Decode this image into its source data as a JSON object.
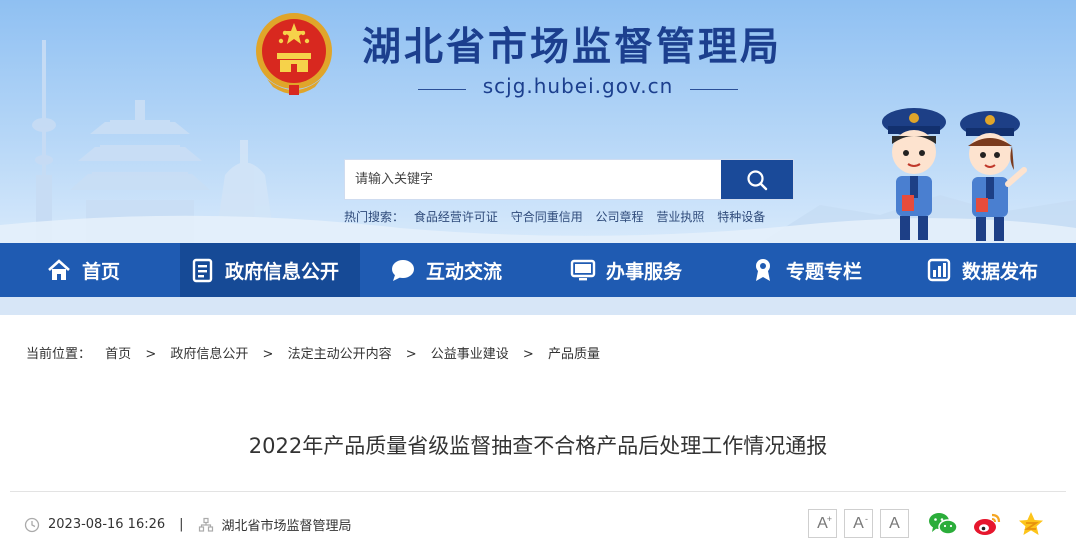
{
  "header": {
    "title": "湖北省市场监督管理局",
    "url": "scjg.hubei.gov.cn",
    "emblem_icon": "national-emblem-icon"
  },
  "search": {
    "placeholder": "请输入关键字",
    "button_icon": "search-icon"
  },
  "hot_search": {
    "label": "热门搜索：",
    "items": [
      "食品经营许可证",
      "守合同重信用",
      "公司章程",
      "营业执照",
      "特种设备"
    ]
  },
  "nav": {
    "items": [
      {
        "label": "首页",
        "icon": "home-icon"
      },
      {
        "label": "政府信息公开",
        "icon": "document-icon"
      },
      {
        "label": "互动交流",
        "icon": "chat-icon"
      },
      {
        "label": "办事服务",
        "icon": "monitor-icon"
      },
      {
        "label": "专题专栏",
        "icon": "ribbon-icon"
      },
      {
        "label": "数据发布",
        "icon": "chart-icon"
      }
    ],
    "active_index": 1
  },
  "breadcrumb": {
    "label": "当前位置：",
    "items": [
      "首页",
      "政府信息公开",
      "法定主动公开内容",
      "公益事业建设",
      "产品质量"
    ],
    "separator": ">"
  },
  "article": {
    "title": "2022年产品质量省级监督抽查不合格产品后处理工作情况通报",
    "date": "2023-08-16 16:26",
    "separator": "|",
    "source": "湖北省市场监督管理局"
  },
  "font_controls": {
    "increase": "A",
    "increase_mark": "+",
    "decrease": "A",
    "decrease_mark": "-",
    "reset": "A"
  },
  "share": [
    "wechat-icon",
    "weibo-icon",
    "qzone-icon"
  ],
  "colors": {
    "nav_bg": "#1f5bb2",
    "nav_active": "#164a96",
    "title": "#1c3f8e",
    "search_button": "#1a4a99"
  }
}
